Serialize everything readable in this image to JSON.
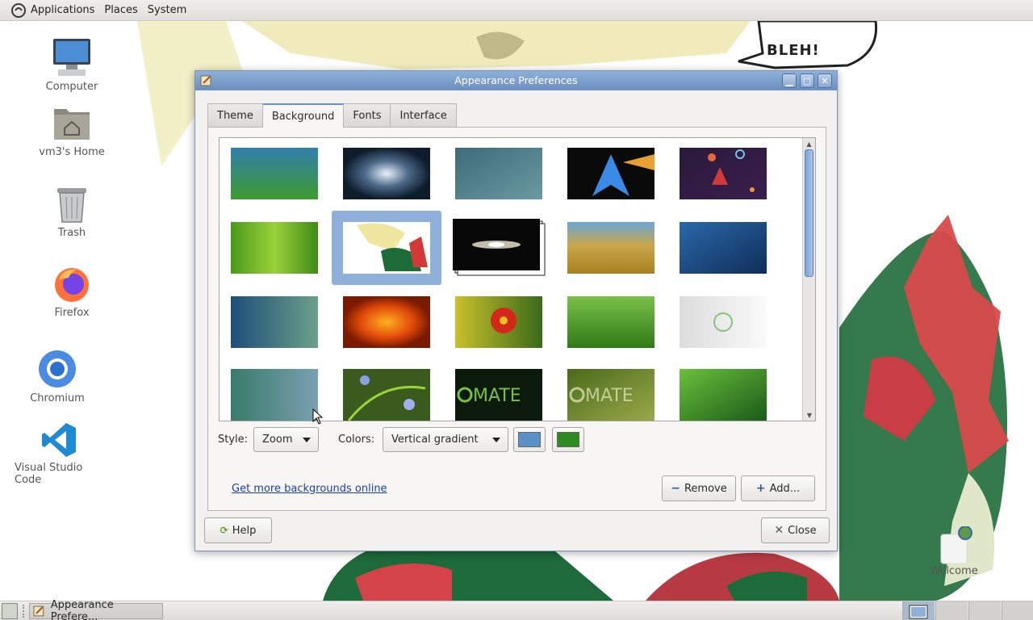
{
  "top_panel": {
    "menus": [
      "Applications",
      "Places",
      "System"
    ]
  },
  "desktop": {
    "icons": [
      {
        "label": "Computer",
        "icon": "computer-icon"
      },
      {
        "label": "vm3's Home",
        "icon": "home-folder-icon"
      },
      {
        "label": "Trash",
        "icon": "trash-icon"
      },
      {
        "label": "Firefox",
        "icon": "firefox-icon"
      },
      {
        "label": "Chromium",
        "icon": "chromium-icon"
      },
      {
        "label": "Visual Studio Code",
        "icon": "vscode-icon"
      }
    ],
    "bubble_text": "BLEH!",
    "welcome_label": "Welcome"
  },
  "window": {
    "title": "Appearance Preferences",
    "tabs": [
      {
        "label": "Theme",
        "active": false
      },
      {
        "label": "Background",
        "active": true
      },
      {
        "label": "Fonts",
        "active": false
      },
      {
        "label": "Interface",
        "active": false
      }
    ],
    "mate_thumb_text": "MATE",
    "style_label": "Style:",
    "style_value": "Zoom",
    "colors_label": "Colors:",
    "colors_value": "Vertical gradient",
    "primary_color": "#5b8fc7",
    "secondary_color": "#2e8b20",
    "more_link": "Get more backgrounds online",
    "remove_label": "Remove",
    "add_label": "Add...",
    "help_label": "Help",
    "close_label": "Close"
  },
  "taskbar": {
    "task_label": "Appearance Prefere..."
  }
}
